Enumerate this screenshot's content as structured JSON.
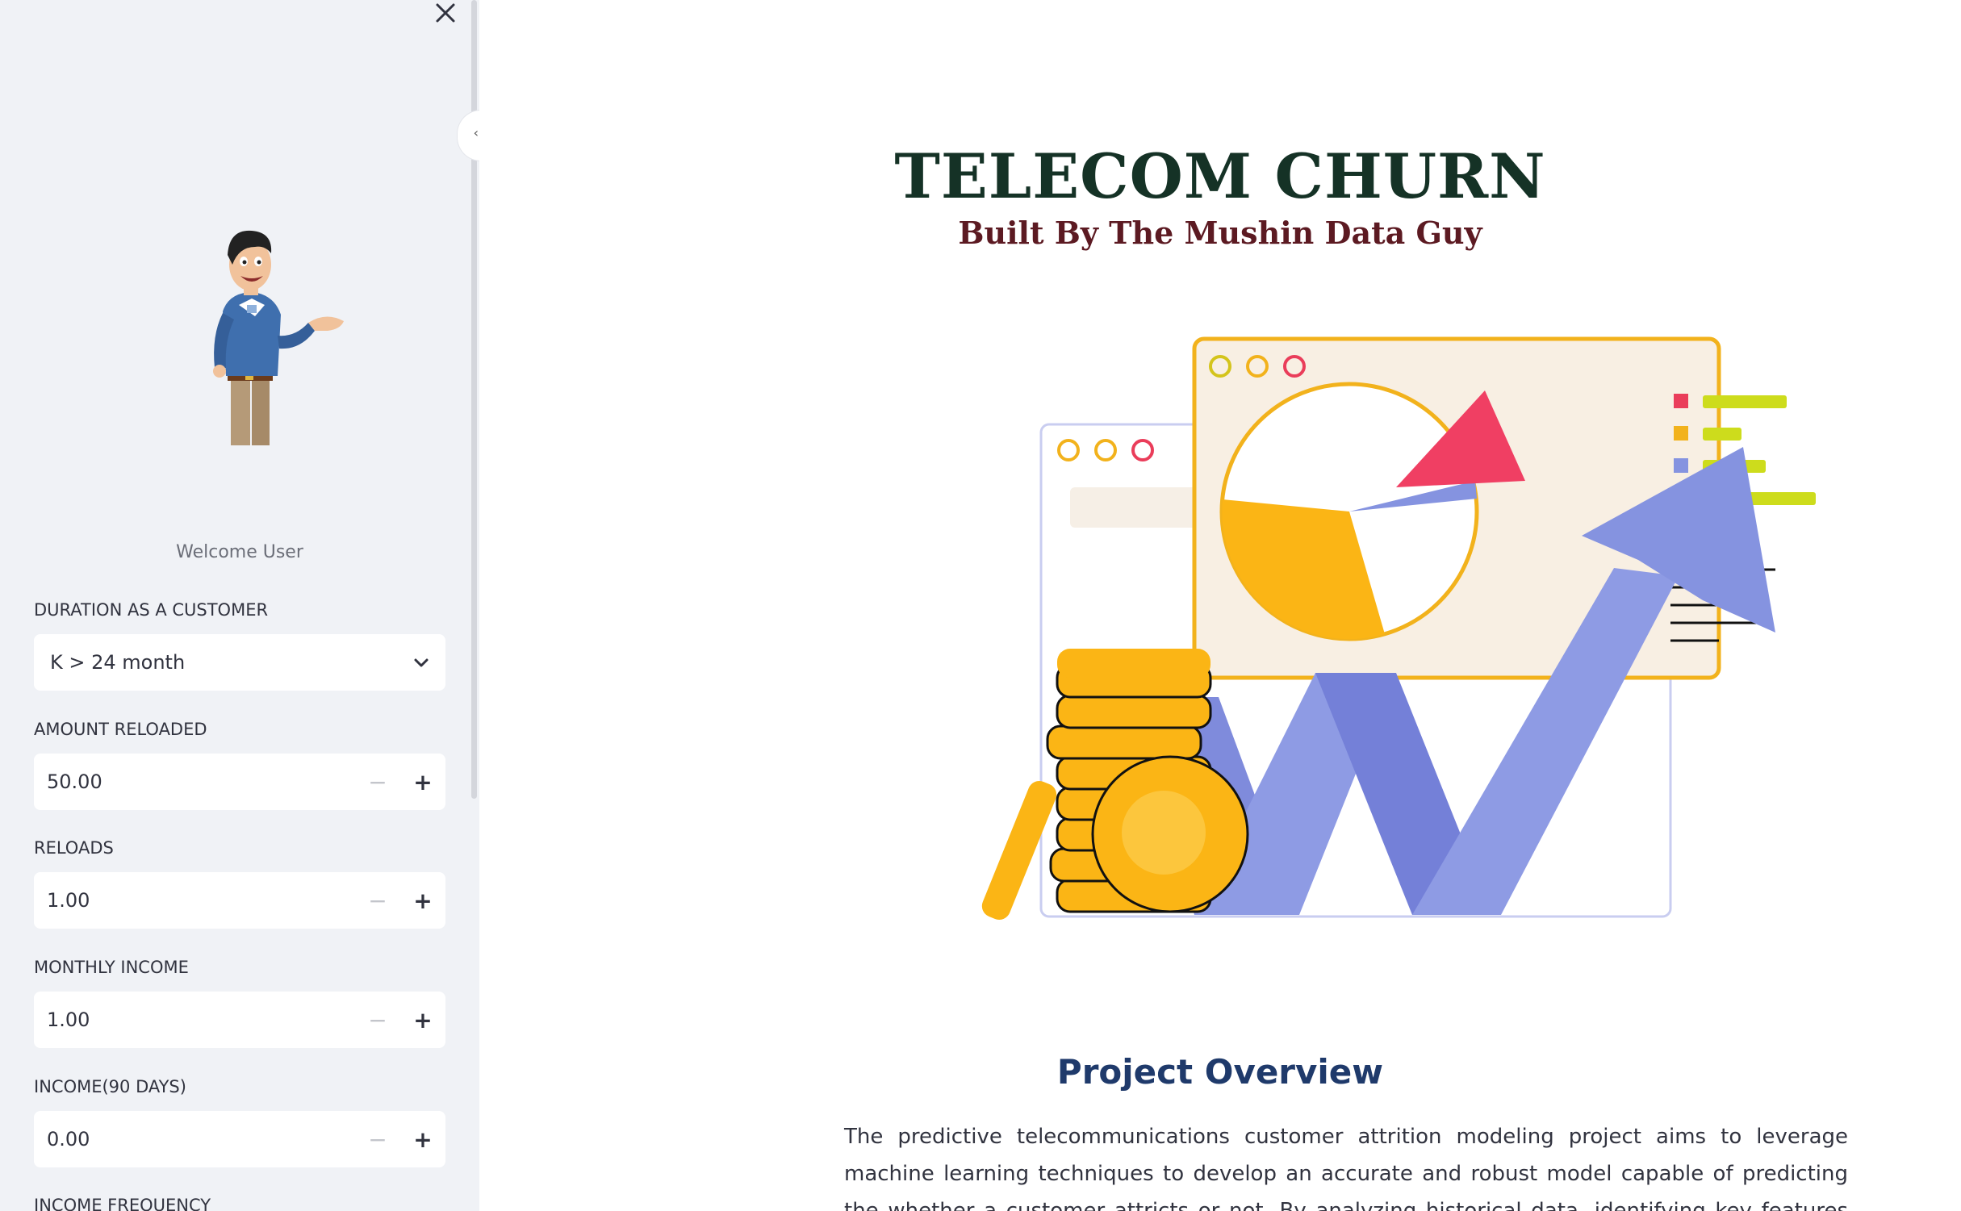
{
  "sidebar": {
    "welcome": "Welcome User",
    "fields": {
      "duration": {
        "label": "DURATION AS A CUSTOMER",
        "value": "K > 24 month"
      },
      "amount_reloaded": {
        "label": "AMOUNT RELOADED",
        "value": "50.00"
      },
      "reloads": {
        "label": "RELOADS",
        "value": "1.00"
      },
      "monthly_income": {
        "label": "MONTHLY INCOME",
        "value": "1.00"
      },
      "income_90": {
        "label": "INCOME(90 DAYS)",
        "value": "0.00"
      },
      "income_frequency": {
        "label": "INCOME FREQUENCY"
      }
    },
    "stepper": {
      "minus": "−",
      "plus": "+"
    }
  },
  "main": {
    "title": "TELECOM CHURN",
    "subtitle": "Built By The Mushin Data Guy",
    "overview_title": "Project Overview",
    "overview_text": "The predictive telecommunications customer attrition modeling project aims to leverage machine learning techniques to develop an accurate and robust model capable of predicting the whether a customer attricts or not. By analyzing historical data, identifying key features influencing customer's descision, and"
  },
  "colors": {
    "sidebar_bg": "#f0f2f6",
    "title": "#153226",
    "subtitle": "#5c1a22",
    "overview_title": "#1f3a6b",
    "coin": "#fbb515",
    "arrow": "#8593e0"
  }
}
